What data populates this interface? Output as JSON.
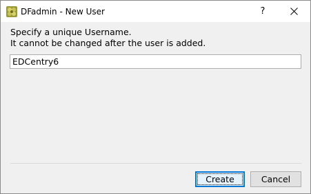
{
  "window": {
    "title": "DFadmin - New User",
    "help_label": "?",
    "app_icon": "dfadmin-app-icon",
    "close_icon": "close-icon"
  },
  "prompt": {
    "line1": "Specify a unique Username.",
    "line2": "It cannot be changed after the user is added."
  },
  "username": {
    "value": "EDCentry6"
  },
  "buttons": {
    "create_label": "Create",
    "cancel_label": "Cancel"
  },
  "colors": {
    "focus_accent": "#0078d7",
    "dialog_bg": "#f0f0f0"
  }
}
